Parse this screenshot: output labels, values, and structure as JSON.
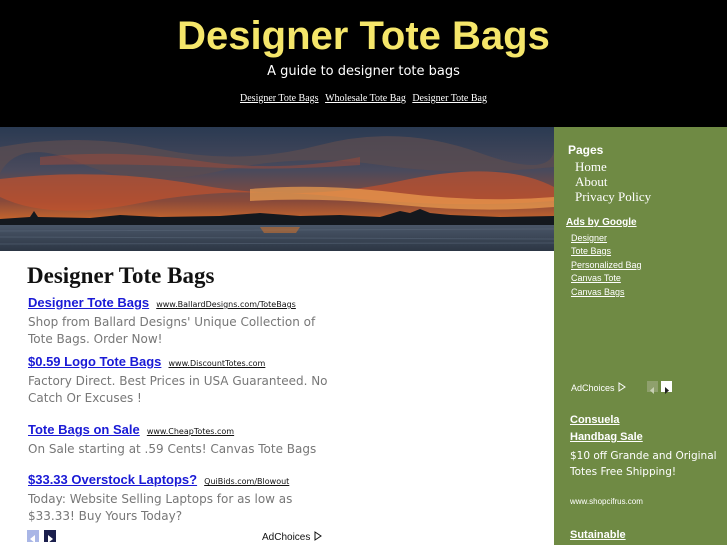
{
  "header": {
    "title": "Designer Tote Bags",
    "tagline": "A guide to designer tote bags",
    "links": [
      "Designer Tote Bags",
      "Wholesale Tote Bag",
      "Designer Tote Bag"
    ]
  },
  "main": {
    "post_title": "Designer Tote Bags",
    "ads": [
      {
        "title": "Designer Tote Bags",
        "url": "www.BallardDesigns.com/ToteBags",
        "desc": "Shop from Ballard Designs' Unique Collection of Tote Bags. Order Now!"
      },
      {
        "title": "$0.59 Logo Tote Bags",
        "url": "www.DiscountTotes.com",
        "desc": "Factory Direct. Best Prices in USA Guaranteed. No Catch Or Excuses !"
      },
      {
        "title": "Tote Bags on Sale",
        "url": "www.CheapTotes.com",
        "desc": "On Sale starting at .59 Cents! Canvas Tote Bags"
      },
      {
        "title": "$33.33 Overstock Laptops?",
        "url": "QuiBids.com/Blowout",
        "desc": "Today: Website Selling Laptops for as low as $33.33! Buy Yours Today?"
      }
    ],
    "adchoices": "AdChoices"
  },
  "sidebar": {
    "pages_heading": "Pages",
    "pages": [
      "Home",
      "About",
      "Privacy Policy"
    ],
    "ads_by_google": "Ads by Google",
    "ad_links": [
      "Designer",
      "Tote Bags",
      "Personalized Bag",
      "Canvas Tote",
      "Canvas Bags"
    ],
    "adchoices": "AdChoices",
    "ad1_title_line1": "Consuela",
    "ad1_title_line2": "Handbag Sale",
    "ad1_desc": "$10 off Grande and Original Totes Free Shipping!",
    "ad1_url": "www.shopcifrus.com",
    "ad2_title": "Sutainable"
  },
  "colors": {
    "header_bg": "#000000",
    "title_yellow": "#f5e66a",
    "sidebar_green": "#6f8a44",
    "ad_link_blue": "#1a1ad6"
  }
}
